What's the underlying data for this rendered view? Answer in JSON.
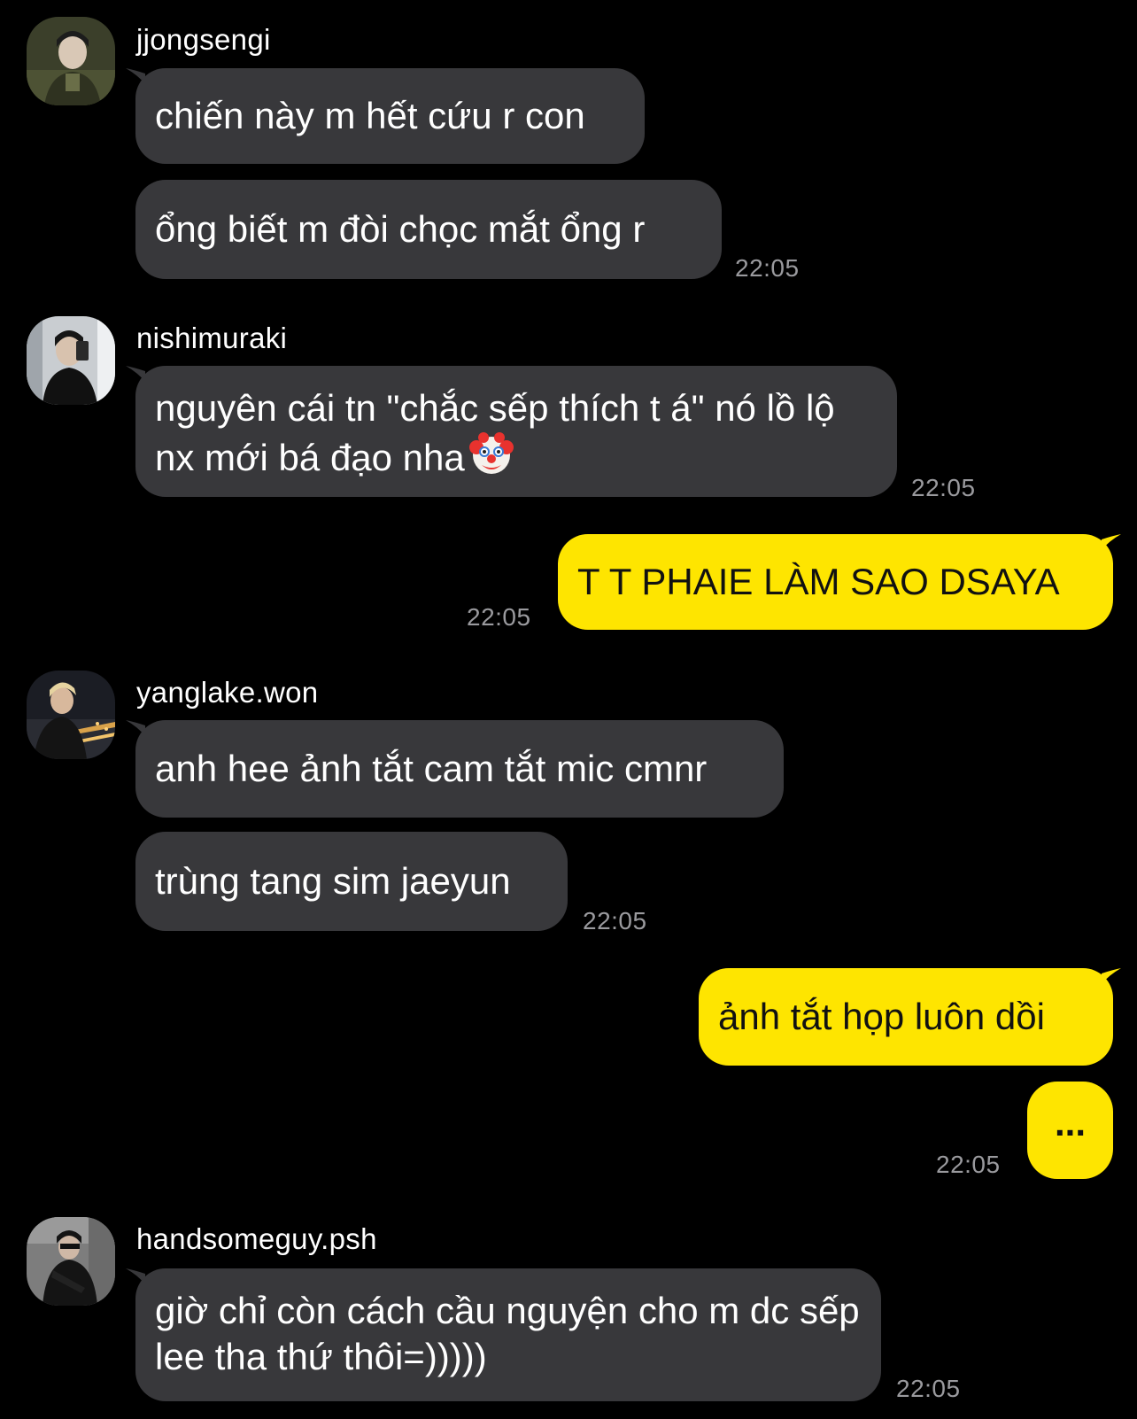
{
  "colors": {
    "background": "#000000",
    "incoming_bubble": "#38383b",
    "outgoing_bubble": "#fee500",
    "timestamp": "#9a9a9e"
  },
  "groups": [
    {
      "sender": "jjongsengi",
      "avatar": "avatar-photo",
      "messages": [
        "chiến này m hết cứu r con",
        "ổng biết m đòi chọc mắt ổng r"
      ],
      "time": "22:05"
    },
    {
      "sender": "nishimuraki",
      "avatar": "avatar-photo",
      "messages": [
        "nguyên cái tn \"chắc sếp thích t á\" nó lồ lộ nx mới bá đạo nha"
      ],
      "emoji": "clown-face-emoji",
      "time": "22:05"
    },
    {
      "outgoing": true,
      "messages": [
        "T T PHAIE LÀM SAO DSAYA"
      ],
      "time": "22:05"
    },
    {
      "sender": "yanglake.won",
      "avatar": "avatar-photo",
      "messages": [
        "anh hee ảnh tắt cam tắt mic cmnr",
        "trùng tang sim jaeyun"
      ],
      "time": "22:05"
    },
    {
      "outgoing": true,
      "messages": [
        "ảnh tắt họp luôn dồi",
        "..."
      ],
      "time": "22:05"
    },
    {
      "sender": "handsomeguy.psh",
      "avatar": "avatar-photo",
      "messages": [
        "giờ chỉ còn cách cầu nguyện cho m dc sếp lee tha thứ thôi=)))))"
      ],
      "time": "22:05"
    }
  ]
}
